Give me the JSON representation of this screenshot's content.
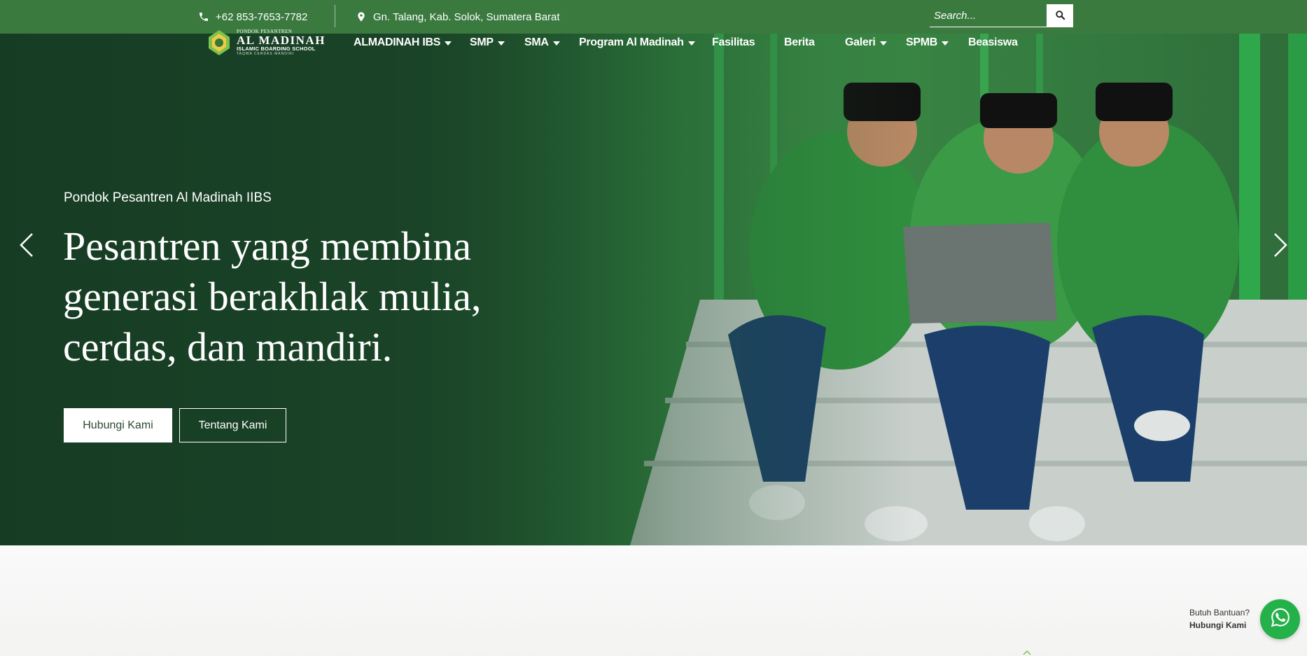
{
  "topbar": {
    "phone": "+62 853-7653-7782",
    "address": "Gn. Talang, Kab. Solok, Sumatera Barat",
    "search_placeholder": "Search...",
    "icons": {
      "phone": "phone-icon",
      "location": "map-pin-icon",
      "search": "search-icon"
    }
  },
  "logo": {
    "small": "PONDOK PESANTREN",
    "name": "AL MADINAH",
    "sub": "ISLAMIC BOARDING SCHOOL",
    "tagline": "TAQWA CERDAS MANDIRI"
  },
  "nav": {
    "items": [
      {
        "label": "ALMADINAH IBS",
        "dropdown": true
      },
      {
        "label": "SMP",
        "dropdown": true
      },
      {
        "label": "SMA",
        "dropdown": true
      },
      {
        "label": "Program Al Madinah",
        "dropdown": true
      },
      {
        "label": "Fasilitas",
        "dropdown": false
      },
      {
        "label": "Berita",
        "dropdown": false
      },
      {
        "label": "Galeri",
        "dropdown": true
      },
      {
        "label": "SPMB",
        "dropdown": true
      },
      {
        "label": "Beasiswa",
        "dropdown": false
      }
    ]
  },
  "hero": {
    "kicker": "Pondok Pesantren Al Madinah IIBS",
    "title": "Pesantren yang membina generasi berakhlak mulia, cerdas, dan mandiri.",
    "primary_button": "Hubungi Kami",
    "secondary_button": "Tentang Kami",
    "prev_icon": "chevron-left-icon",
    "next_icon": "chevron-right-icon"
  },
  "help": {
    "title": "Butuh Bantuan?",
    "cta": "Hubungi Kami",
    "icon": "whatsapp-icon"
  },
  "colors": {
    "brand_green": "#3a7a3f",
    "dark_green": "#1c4a2b",
    "whatsapp": "#25b14a"
  }
}
